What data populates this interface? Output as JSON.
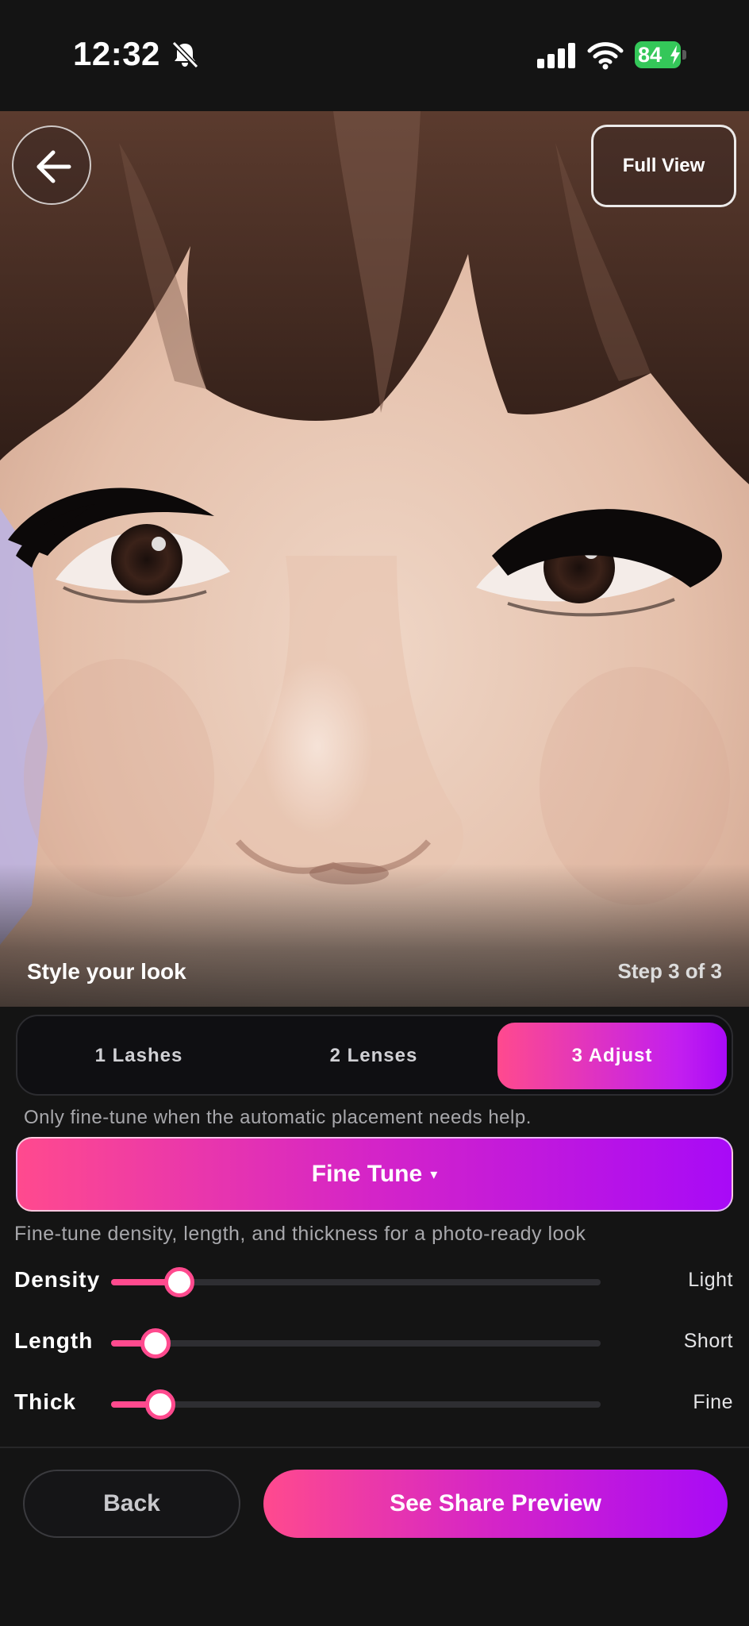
{
  "status_bar": {
    "time": "12:32",
    "battery": "84",
    "icons": [
      "bell-slash-icon",
      "cellular-signal-icon",
      "wifi-icon",
      "battery-charging-icon"
    ]
  },
  "photo": {
    "full_view_label": "Full View",
    "caption": "Style your look",
    "step": "Step 3 of 3",
    "back_icon": "arrow-left-icon"
  },
  "tabs": [
    {
      "label": "1  Lashes",
      "active": false
    },
    {
      "label": "2  Lenses",
      "active": false
    },
    {
      "label": "3  Adjust",
      "active": true
    }
  ],
  "hint": "Only fine-tune when the automatic placement needs help.",
  "fine_tune": {
    "label": "Fine Tune",
    "caret": "▾"
  },
  "subtitle": "Fine-tune density, length, and thickness for a photo-ready look",
  "sliders": [
    {
      "label": "Density",
      "value_label": "Light",
      "level": 0.14
    },
    {
      "label": "Length",
      "value_label": "Short",
      "level": 0.09
    },
    {
      "label": "Thick",
      "value_label": "Fine",
      "level": 0.1
    }
  ],
  "buttons": {
    "back": "Back",
    "share": "See Share Preview"
  },
  "colors": {
    "accent_pink": "#ff4a8e",
    "accent_purple": "#a80af7",
    "background": "#141414",
    "battery_green": "#34c759"
  }
}
